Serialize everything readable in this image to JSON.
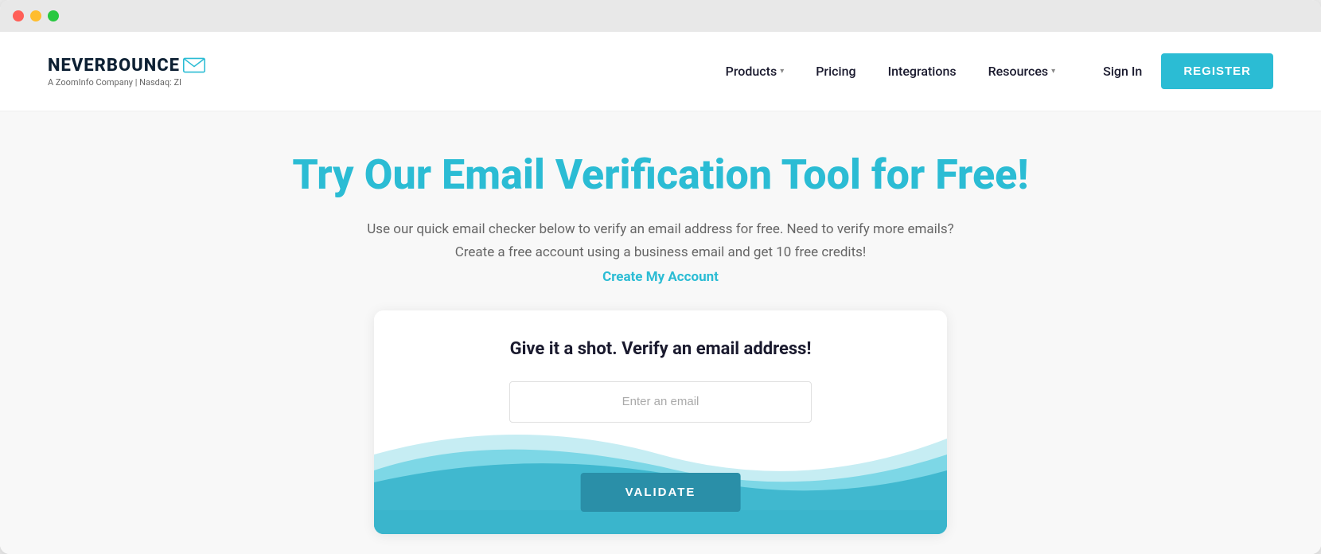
{
  "browser": {
    "dots": [
      "red",
      "yellow",
      "green"
    ]
  },
  "navbar": {
    "logo_text": "NEVERBOUNCE",
    "logo_sub": "A ZoomInfo Company | Nasdaq: ZI",
    "nav_items": [
      {
        "label": "Products",
        "has_dropdown": true
      },
      {
        "label": "Pricing",
        "has_dropdown": false
      },
      {
        "label": "Integrations",
        "has_dropdown": false
      },
      {
        "label": "Resources",
        "has_dropdown": true
      }
    ],
    "sign_in_label": "Sign In",
    "register_label": "REGISTER"
  },
  "hero": {
    "headline": "Try Our Email Verification Tool for Free!",
    "subtext_line1": "Use our quick email checker below to verify an email address for free. Need to verify more emails?",
    "subtext_line2": "Create a free account using a business email and get 10 free credits!",
    "create_account_label": "Create My Account"
  },
  "card": {
    "title": "Give it a shot. Verify an email address!",
    "email_placeholder": "Enter an email",
    "validate_label": "VALIDATE"
  },
  "colors": {
    "teal": "#2bbcd4",
    "dark_teal": "#2a8fa8",
    "navy": "#0d2033",
    "wave1": "#3ab5cc",
    "wave2": "#5ecde0",
    "wave3": "#8ddce8"
  }
}
